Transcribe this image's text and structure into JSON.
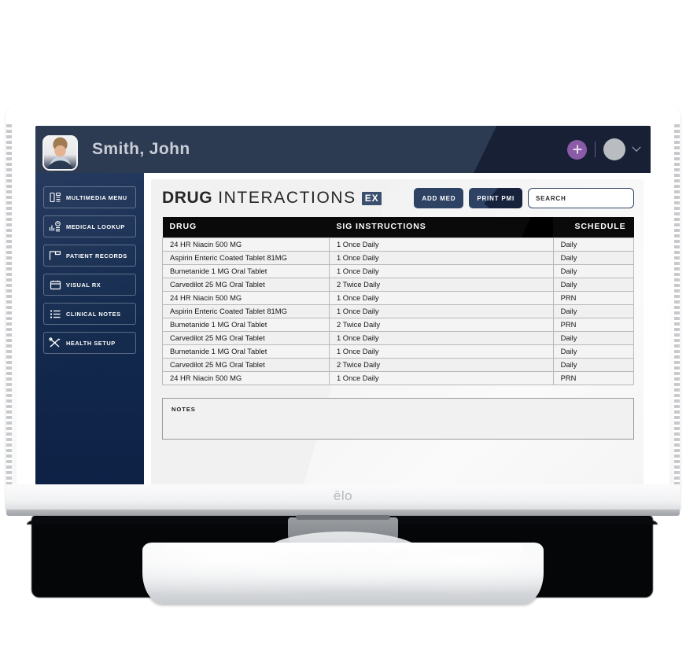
{
  "device": {
    "brand_logo": "ēlo"
  },
  "topbar": {
    "patient_name": "Smith, John",
    "avatar_alt": "patient-photo",
    "add_button_label": "+",
    "icons": {
      "plus": "plus-icon",
      "avatar": "avatar-icon",
      "chevron": "chevron-down-icon"
    }
  },
  "sidebar": {
    "items": [
      {
        "label": "MULTIMEDIA MENU",
        "icon": "multimedia-icon"
      },
      {
        "label": "MEDICAL LOOKUP",
        "icon": "chart-clock-icon"
      },
      {
        "label": "PATIENT RECORDS",
        "icon": "folder-flag-icon"
      },
      {
        "label": "VISUAL RX",
        "icon": "window-icon"
      },
      {
        "label": "CLINICAL NOTES",
        "icon": "list-icon"
      },
      {
        "label": "HEALTH SETUP",
        "icon": "tools-icon"
      }
    ]
  },
  "panel": {
    "title_bold": "DRUG",
    "title_thin": "INTERACTIONS",
    "title_badge": "EX",
    "buttons": {
      "add_med": "ADD MED",
      "print_pmi": "PRINT PMI"
    },
    "search": {
      "placeholder": "SEARCH",
      "value": ""
    },
    "table": {
      "columns": [
        "DRUG",
        "SIG INSTRUCTIONS",
        "SCHEDULE"
      ],
      "rows": [
        [
          "24 HR Niacin 500 MG",
          "1 Once Daily",
          "Daily"
        ],
        [
          "Aspirin Enteric Coated Tablet 81MG",
          "1 Once Daily",
          "Daily"
        ],
        [
          "Bumetanide 1 MG Oral Tablet",
          "1 Once Daily",
          "Daily"
        ],
        [
          "Carvedilot 25 MG Oral Tablet",
          "2 Twice Daily",
          "Daily"
        ],
        [
          "24 HR Niacin 500 MG",
          "1 Once Daily",
          "PRN"
        ],
        [
          "Aspirin Enteric Coated Tablet 81MG",
          "1 Once Daily",
          "Daily"
        ],
        [
          "Bumetanide 1 MG Oral Tablet",
          "2 Twice Daily",
          "PRN"
        ],
        [
          "Carvedilot 25 MG Oral Tablet",
          "1 Once Daily",
          "Daily"
        ],
        [
          "Bumetanide 1 MG Oral Tablet",
          "1 Once Daily",
          "Daily"
        ],
        [
          "Carvedilot 25 MG Oral Tablet",
          "2 Twice Daily",
          "Daily"
        ],
        [
          "24 HR Niacin 500 MG",
          "1 Once Daily",
          "PRN"
        ]
      ]
    },
    "notes": {
      "label": "NOTES",
      "value": ""
    }
  },
  "colors": {
    "topbar": "#2c3a52",
    "sidebar": "#132a4e",
    "accent_button": "#2e4264",
    "badge": "#3b4f6e",
    "plus_button": "#8a5ba6",
    "table_header": "#0a0a0a",
    "panel_bg": "#f1f1f1"
  }
}
